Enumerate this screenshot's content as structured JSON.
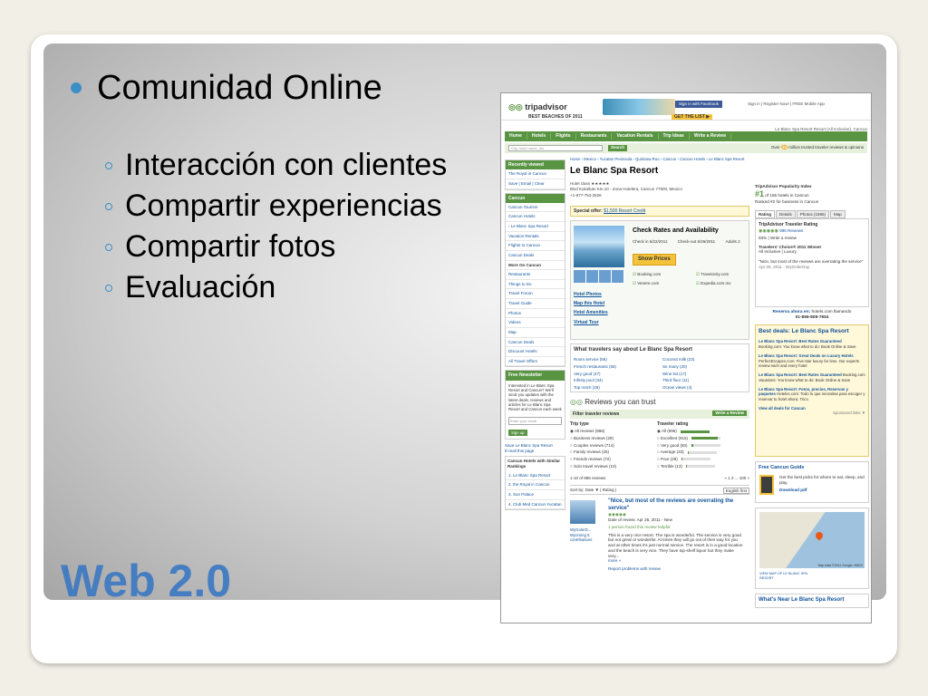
{
  "slide": {
    "bullet_main": "Comunidad Online",
    "sub_bullets": [
      "Interacción con clientes",
      "Compartir experiencias",
      "Compartir fotos",
      "Evaluación"
    ],
    "footer_title": "Web 2.0",
    "accent_color": "#3b8fc6",
    "title_color": "#3a78c3"
  },
  "ta": {
    "logo": "tripadvisor",
    "banner": "BEST BEACHES OF 2011",
    "get_list": "GET THE LIST ▶",
    "facebook": "Sign in with Facebook",
    "toplinks": "Sign in | Register Now! | FREE Mobile App",
    "hotel_top": "Le Blanc Spa Resort Resort (All Inclusive), Cancun",
    "nav": [
      "Home",
      "Hotels",
      "Flights",
      "Restaurants",
      "Vacation Rentals",
      "Trip Ideas",
      "Write a Review"
    ],
    "search_placeholder": "City, hotel name, etc.",
    "search_btn": "Search",
    "trust": "million trusted traveler reviews & opinions",
    "trust_num": "45",
    "sidebar": {
      "recent_head": "Recently viewed",
      "recent": [
        "The Royal in Cancun",
        "Save | Email | Clear"
      ],
      "cancun_head": "Cancun",
      "cancun": [
        "Cancun Tourism",
        "Cancun Hotels",
        "› Le Blanc Spa Resort",
        "Vacation Rentals",
        "Flights to Cancun",
        "Cancun Deals"
      ],
      "more_head": "More On Cancun",
      "more": [
        "Restaurants",
        "Things to Do",
        "Travel Forum",
        "Travel Guide",
        "Photos",
        "Videos",
        "Map",
        "Cancun Deals",
        "Discount Hotels",
        "All Travel Offers"
      ],
      "news_head": "Free Newsletter",
      "news_text": "Interested in Le Blanc Spa Resort and Cancun? We'll send you updates with the latest deals, reviews and articles for Le Blanc Spa Resort and Cancun each week",
      "email_ph": "Enter your email",
      "signup": "Sign up",
      "save": "Save Le Blanc Spa Resort",
      "email_page": "E-mail this page",
      "similar_head": "Cancun Hotels with Similar Rankings",
      "similar": [
        "1. Le Blanc Spa Resort",
        "2. the Royal in Cancun",
        "3. Sun Palace",
        "4. Club Med Cancun Yucatan"
      ]
    },
    "main": {
      "crumb": "Home › Mexico › Yucatan Peninsula › Quintana Roo › Cancun › Cancun Hotels › Le Blanc Spa Resort",
      "title": "Le Blanc Spa Resort",
      "hotel_class": "Hotel class ★★★★★",
      "address": "Blvd Kukulkan Km.10 - Zona Hotelera, Cancun 77500, Mexico",
      "phone": "+1-877-753-2526",
      "special_label": "Special offer:",
      "special_link": "$1,500 Resort Credit",
      "check_title": "Check Rates and Availability",
      "checkin": "Check in 6/22/2011",
      "checkout": "Check-out 6/26/2011",
      "adults": "Adults 2",
      "show_prices": "Show Prices",
      "sites": [
        "Booking.com",
        "Travelocity.com",
        "Venere.com",
        "Expedia.com.mx"
      ],
      "photo_links": [
        "Hotel Photos",
        "Map this Hotel",
        "Hotel Amenities",
        "Virtual Tour"
      ],
      "wts_title": "What travelers say about Le Blanc Spa Resort",
      "wts": [
        "Room service (56)",
        "Coconut milk (23)",
        "French restaurants (56)",
        "Se many (20)",
        "Very good (47)",
        "Wine list (17)",
        "Infinity pool (34)",
        "Third floor (11)",
        "Top notch (29)",
        "Ocean views (4)"
      ],
      "reviews_head": "Reviews you can trust",
      "filter": "Filter traveler reviews",
      "write_review": "Write a Review",
      "trip_type_head": "Trip type",
      "trip_types": [
        "All reviews (996)",
        "Business reviews (28)",
        "Couples reviews (714)",
        "Family reviews (25)",
        "Friends reviews (72)",
        "Solo travel reviews (10)"
      ],
      "rating_head": "Traveler rating",
      "ratings": [
        {
          "label": "All (996)",
          "fill": 1.0
        },
        {
          "label": "Excellent (915)",
          "fill": 0.92
        },
        {
          "label": "Very good (60)",
          "fill": 0.08
        },
        {
          "label": "Average (33)",
          "fill": 0.05
        },
        {
          "label": "Poor (29)",
          "fill": 0.03
        },
        {
          "label": "Terrible (13)",
          "fill": 0.02
        }
      ],
      "pager_left": "1-10 of 996 reviews",
      "pager_right": "« 1 2 ... 100 »",
      "sortby": "Sort by: Date ▼ | Rating |",
      "lang": "English first",
      "reviewer": "WyGolerD... Wyoming 5 contributions",
      "quote": "\"Nice, but most of the reviews are overrating the service\"",
      "review_date": "Date of review: Apr 26, 2011 - New",
      "helpful": "1 person found this review helpful",
      "review_body": "This is a very nice resort. The spa is wonderful. The service is very good but not great or wonderful. At times they will go out of their way for you and at other times it's just normal service. The resort is in a good location and the beach is very nice. They have top-shelf liquor but they make very...",
      "more": "more »",
      "problem": "Report problems with review"
    },
    "right": {
      "pop_title": "TripAdvisor Popularity Index",
      "pop_rank": "#1",
      "pop_of": "of 165 hotels in Cancun",
      "ranked": "Ranked #2 for business in Cancun",
      "tabs": [
        "Rating",
        "Details",
        "Photos (1586)",
        "Map"
      ],
      "tr_title": "TripAdvisor Traveler Rating",
      "tr_reviews": "996 Reviews",
      "tr_rec": "93% | Write a review",
      "tc": "Travelers' Choice® 2011 Winner",
      "tc_cat": "All Inclusive | Luxury",
      "tr_quote": "\"Nice, but most of the reviews are overrating the service\"",
      "tr_date": "Apr 26, 2011 - WyGolerGuy",
      "reserva_label": "Reserva ahora en:",
      "reserva_site": "hotels.com llamando",
      "reserva_phone": "01-866-808-7954",
      "best_title": "Best deals: Le Blanc Spa Resort",
      "deals": [
        {
          "site": "Le Blanc Spa Resort: Best Rates Guaranteed",
          "text": "Booking.com: You know what to do: Book Online & Save"
        },
        {
          "site": "Le Blanc Spa Resort: Great Deals on Luxury Hotels",
          "text": "PerfectEscapes.com: Five-star luxury for less. Our experts review each and every hotel"
        },
        {
          "site": "Le Blanc Spa Resort: Best Rates Guaranteed",
          "text": "Booking.com Vacations: You know what to do: Book Online & Save"
        },
        {
          "site": "Le Blanc Spa Resort: Fotos, precios, Reservas y paquetes",
          "text": "Hoteles.com: Todo lo que necesitas para escoger y reservar tu hotel ahora. Trico"
        }
      ],
      "view_all": "View all deals for Cancun",
      "sponsored": "Sponsored links ▼",
      "guide_title": "Free Cancun Guide",
      "guide_text": "Get the best picks for where to eat, sleep, and play.",
      "guide_dl": "Download pdf",
      "map_caption": "VIEW MAP OF LE BLANC SPA RESORT",
      "map_data": "Map data ©2011 Google, INEGI",
      "near_title": "What's Near Le Blanc Spa Resort"
    }
  }
}
